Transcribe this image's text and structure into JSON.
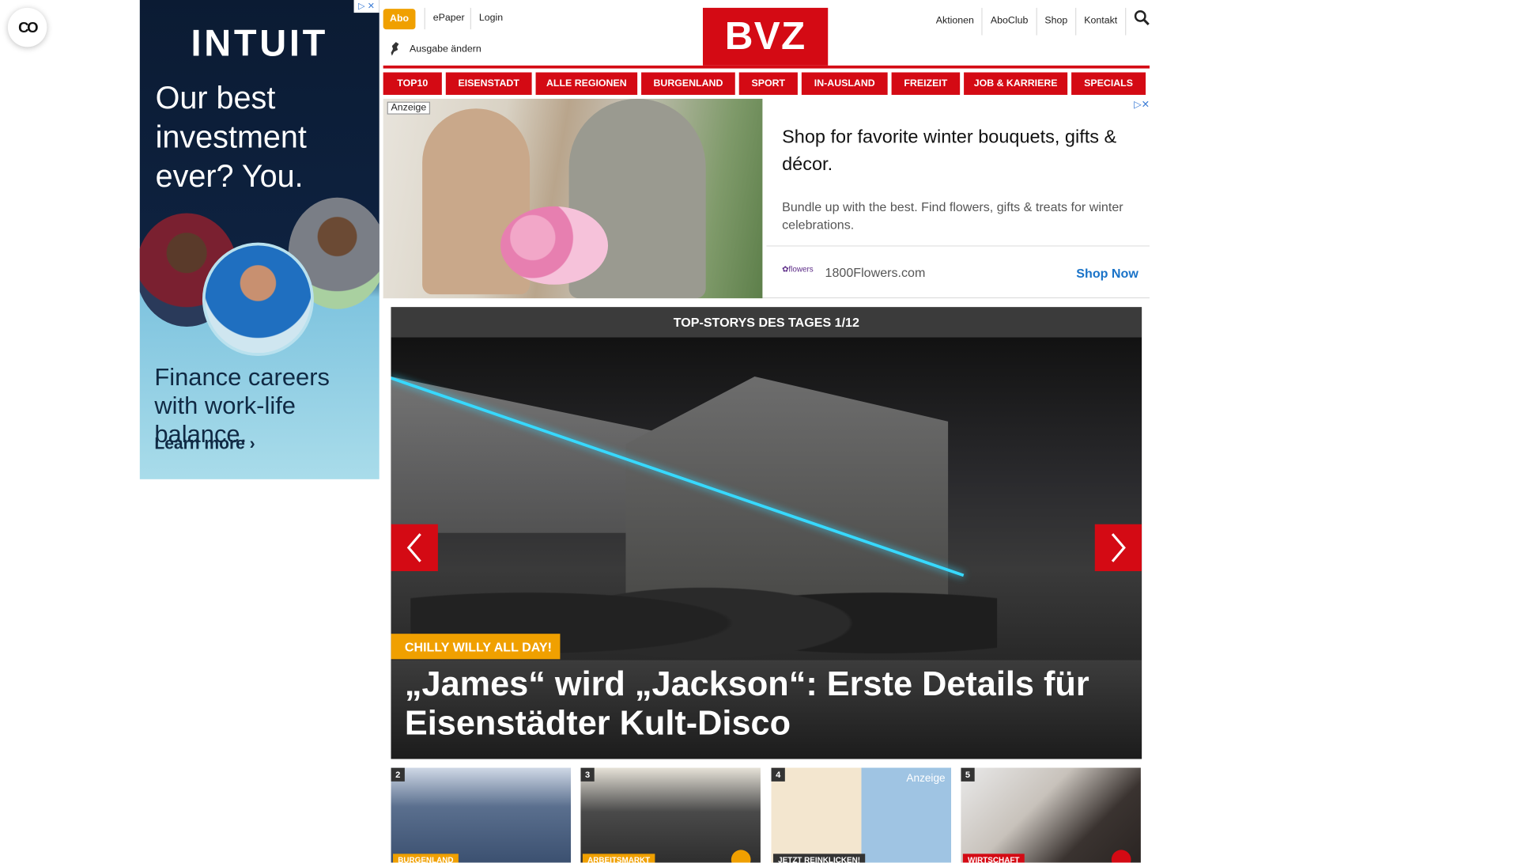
{
  "privacy": {
    "icon": "privacy-icon"
  },
  "side_ad": {
    "brand": "INTUIT",
    "headline": "Our best investment ever? You.",
    "subline": "Finance careers with work-life balance.",
    "cta": "Learn more ›"
  },
  "header": {
    "abo": "Abo",
    "epaper": "ePaper",
    "login": "Login",
    "edition": "Ausgabe ändern",
    "logo": "BVZ",
    "right_links": [
      "Aktionen",
      "AboClub",
      "Shop",
      "Kontakt"
    ],
    "search_icon": "search-icon"
  },
  "nav": [
    "TOP10",
    "EISENSTADT",
    "ALLE REGIONEN",
    "BURGENLAND",
    "SPORT",
    "IN-AUSLAND",
    "FREIZEIT",
    "JOB & KARRIERE",
    "SPECIALS"
  ],
  "banner_ad": {
    "label": "Anzeige",
    "title": "Shop for favorite winter bouquets, gifts & décor.",
    "description": "Bundle up with the best. Find flowers, gifts & treats for winter celebrations.",
    "domain": "1800Flowers.com",
    "cta": "Shop Now"
  },
  "slider": {
    "title": "TOP-STORYS DES TAGES 1/12",
    "kicker": "CHILLY WILLY ALL DAY!",
    "headline": "„James“ wird „Jackson“: Erste Details für Eisenstädter Kult-Disco"
  },
  "thumbs": [
    {
      "num": "2",
      "tag": "BURGENLAND",
      "tag_color": "#f0a000"
    },
    {
      "num": "3",
      "tag": "ARBEITSMARKT",
      "tag_color": "#f0a000"
    },
    {
      "num": "4",
      "tag": "JETZT REINKLICKEN!",
      "tag_color": "#333333",
      "label": "Anzeige"
    },
    {
      "num": "5",
      "tag": "WIRTSCHAFT",
      "tag_color": "#d40a14"
    }
  ],
  "colors": {
    "brand_red": "#d40a14",
    "accent_orange": "#f0a000"
  }
}
